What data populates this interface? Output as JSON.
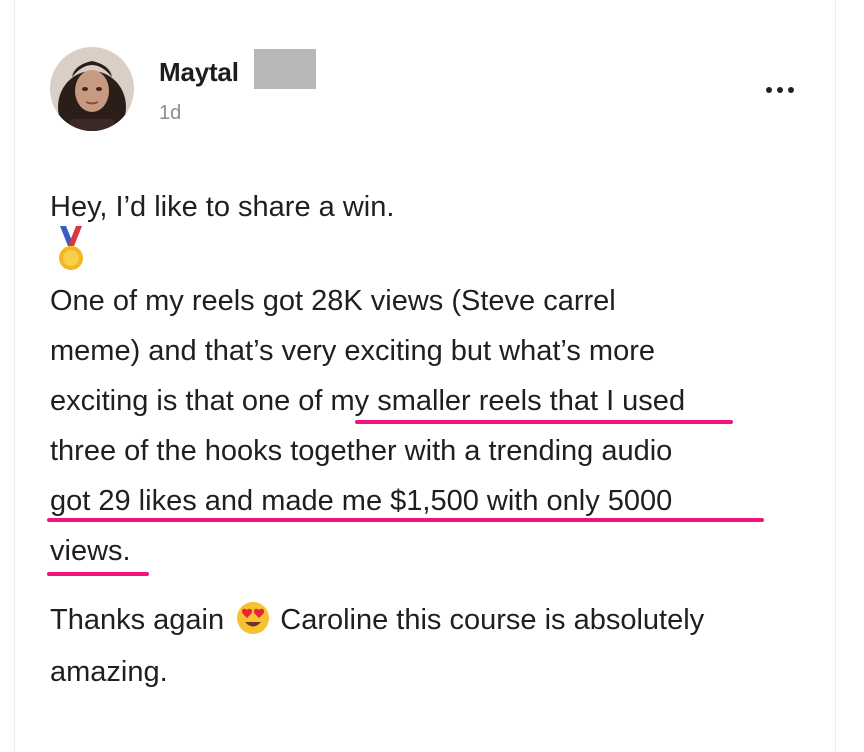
{
  "post": {
    "author_name": "Maytal",
    "timestamp": "1d",
    "more_icon": "more-horizontal-icon",
    "lines": [
      "Hey, I’d like to share a win.",
      "One of my reels got 28K views (Steve carrel",
      "meme) and that’s very exciting but what’s more",
      "exciting is that one of my smaller reels that I used",
      "three of the hooks together with a trending audio",
      "got 29 likes and made me $1,500 with only 5000",
      "views."
    ],
    "closing_before_emoji": "Thanks again",
    "closing_after_emoji": "Caroline this course is absolutely",
    "closing_last": "amazing.",
    "medal_icon": "medal-emoji",
    "face_icon": "heart-eyes-emoji",
    "highlight_color": "#f0147c"
  }
}
